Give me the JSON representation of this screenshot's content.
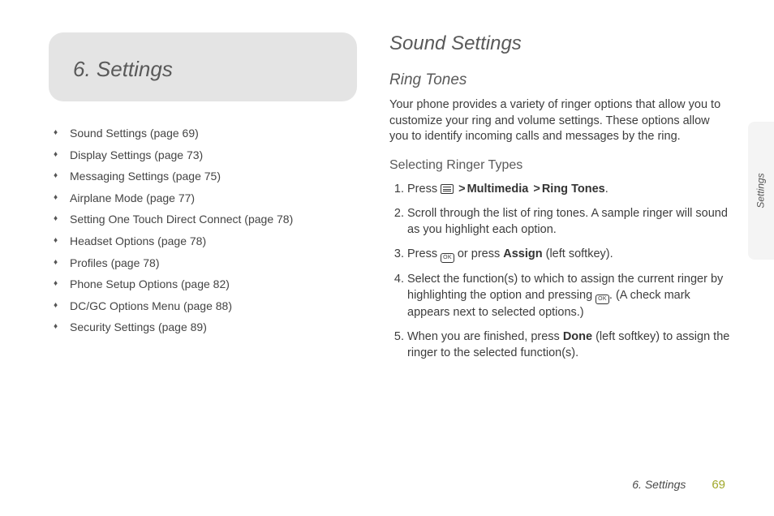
{
  "chapter": {
    "title": "6.  Settings"
  },
  "toc": [
    "Sound Settings (page 69)",
    "Display Settings (page 73)",
    "Messaging Settings (page 75)",
    "Airplane Mode (page 77)",
    "Setting One Touch Direct Connect (page 78)",
    "Headset Options (page 78)",
    "Profiles (page 78)",
    "Phone Setup Options (page 82)",
    "DC/GC Options Menu (page 88)",
    "Security Settings (page 89)"
  ],
  "section": {
    "title": "Sound Settings",
    "sub": "Ring Tones",
    "intro": "Your phone provides a variety of ringer options that allow you to customize your ring and volume settings. These options allow you to identify incoming calls and messages by the ring.",
    "sub3": "Selecting Ringer Types"
  },
  "steps": {
    "s1a": "Press ",
    "s1_path1": "Multimedia",
    "s1_path2": "Ring Tones",
    "s2": "Scroll through the list of ring tones. A sample ringer will sound as you highlight each option.",
    "s3a": "Press ",
    "s3b": " or press ",
    "s3_assign": "Assign",
    "s3c": " (left softkey).",
    "s4a": "Select the function(s) to which to assign the current ringer by highlighting the option and pressing ",
    "s4b": ". (A check mark appears next to selected options.)",
    "s5a": "When you are finished, press ",
    "s5_done": "Done",
    "s5b": " (left softkey) to assign the ringer to the selected function(s)."
  },
  "edgeTab": "Settings",
  "footer": {
    "label": "6. Settings",
    "page": "69"
  }
}
